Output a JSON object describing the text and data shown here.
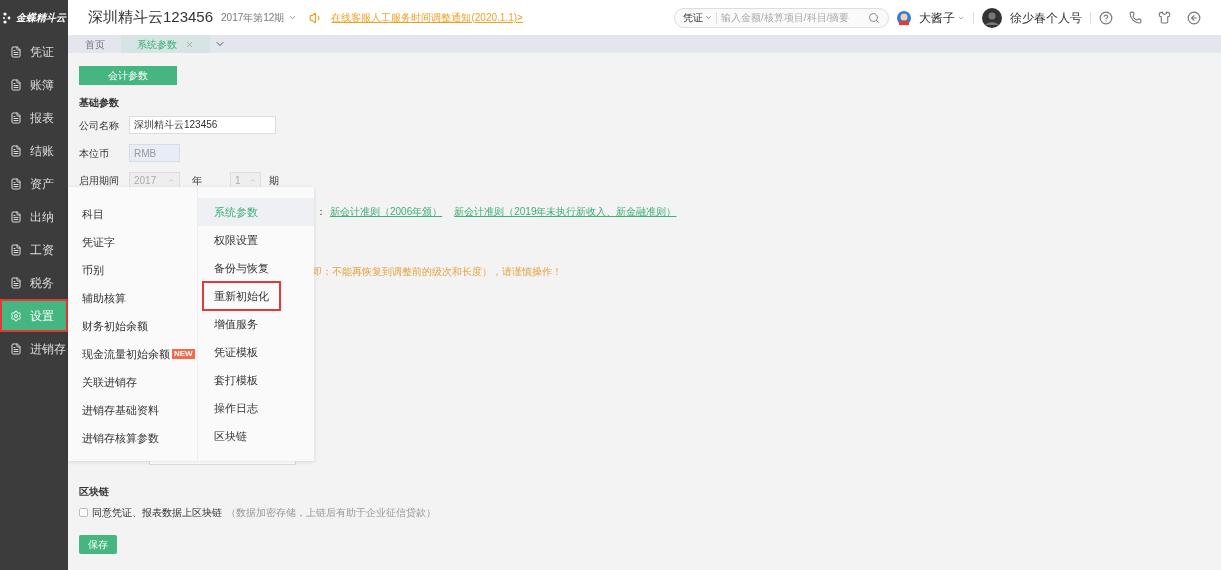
{
  "header": {
    "logo_text": "金蝶精斗云",
    "company": "深圳精斗云123456",
    "period": "2017年第12期",
    "notice": "在线客服人工服务时间调整通知(2020.1.1)>",
    "search": {
      "scope": "凭证",
      "placeholder": "输入金额/核算项目/科目/摘要"
    },
    "user": "大酱子",
    "account": "徐少春个人号"
  },
  "sidebar": {
    "items": [
      {
        "label": "凭证",
        "selected": false,
        "highlighted": false
      },
      {
        "label": "账簿",
        "selected": false,
        "highlighted": false
      },
      {
        "label": "报表",
        "selected": false,
        "highlighted": false
      },
      {
        "label": "结账",
        "selected": false,
        "highlighted": false
      },
      {
        "label": "资产",
        "selected": false,
        "highlighted": false
      },
      {
        "label": "出纳",
        "selected": false,
        "highlighted": false
      },
      {
        "label": "工资",
        "selected": false,
        "highlighted": false
      },
      {
        "label": "税务",
        "selected": false,
        "highlighted": false
      },
      {
        "label": "设置",
        "selected": true,
        "highlighted": true
      },
      {
        "label": "进销存",
        "selected": false,
        "highlighted": false
      }
    ]
  },
  "tabs": [
    {
      "label": "首页",
      "selected": false,
      "closable": false
    },
    {
      "label": "系统参数",
      "selected": true,
      "closable": true
    }
  ],
  "content": {
    "section_button": "会计参数",
    "basic_title": "基础参数",
    "company_field": {
      "label": "公司名称",
      "value": "深圳精斗云123456"
    },
    "currency": {
      "label": "本位币",
      "value": "RMB"
    },
    "start_period": {
      "label": "启用期间",
      "year": "2017",
      "year_unit": "年",
      "period": "1",
      "period_unit": "期"
    },
    "standard": {
      "label_tail": "：",
      "options": [
        "新会计准则（2006年颁）",
        "新会计准则（2019年未执行新收入、新金融准则）"
      ]
    },
    "warning": "即：不能再恢复到调整前的级次和长度），请谨慎操作！",
    "blockchain": {
      "title": "区块链",
      "label": "同意凭证、报表数据上区块链",
      "hint": "（数据加密存储，上链后有助于企业征信贷款）",
      "checked": false
    },
    "save": "保存"
  },
  "menu": {
    "left": [
      {
        "label": "科目"
      },
      {
        "label": "凭证字"
      },
      {
        "label": "币别"
      },
      {
        "label": "辅助核算"
      },
      {
        "label": "财务初始余额"
      },
      {
        "label": "现金流量初始余额",
        "badge": "NEW"
      },
      {
        "label": "关联进销存"
      },
      {
        "label": "进销存基础资料"
      },
      {
        "label": "进销存核算参数"
      }
    ],
    "right": [
      {
        "label": "系统参数",
        "selected": true,
        "highlighted": false
      },
      {
        "label": "权限设置",
        "selected": false,
        "highlighted": false
      },
      {
        "label": "备份与恢复",
        "selected": false,
        "highlighted": false
      },
      {
        "label": "重新初始化",
        "selected": false,
        "highlighted": true
      },
      {
        "label": "增值服务",
        "selected": false,
        "highlighted": false
      },
      {
        "label": "凭证模板",
        "selected": false,
        "highlighted": false
      },
      {
        "label": "套打模板",
        "selected": false,
        "highlighted": false
      },
      {
        "label": "操作日志",
        "selected": false,
        "highlighted": false
      },
      {
        "label": "区块链",
        "selected": false,
        "highlighted": false
      }
    ]
  }
}
